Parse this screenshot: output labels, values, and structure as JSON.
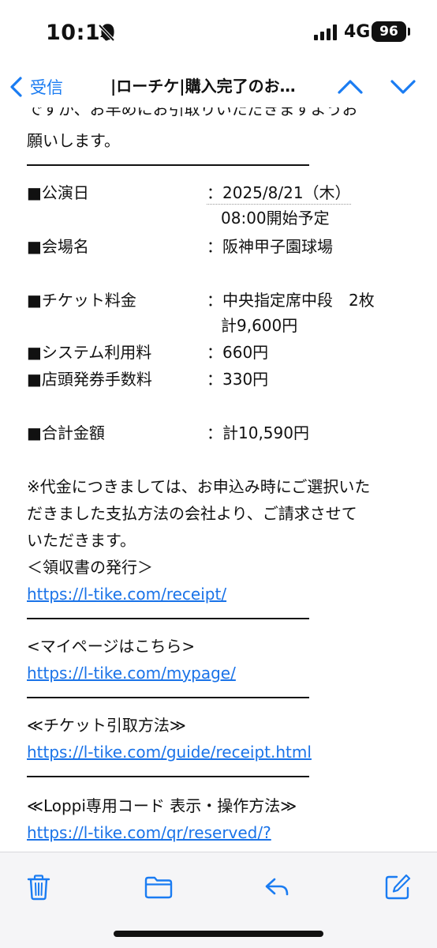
{
  "status_bar": {
    "time": "10:10",
    "network": "4G",
    "battery": "96",
    "icons": [
      "bell-slash-icon",
      "signal-icon"
    ]
  },
  "nav": {
    "back_label": "受信",
    "title": "|ローチケ|購入完了のお…",
    "accent_color": "#1a7cf2"
  },
  "email": {
    "intro_line1": "ですが、お早めにお引取りいただきますようお",
    "intro_line2": "願いします。",
    "rows": [
      {
        "label": "■公演日",
        "value": "：2025/8/21（木）",
        "value2": "08:00開始予定"
      },
      {
        "label": "■会場名",
        "value": "：阪神甲子園球場"
      },
      {
        "label": "■チケット料金",
        "value": "：中央指定席中段　2枚",
        "value2": "計9,600円"
      },
      {
        "label": "■システム利用料",
        "value": "：660円"
      },
      {
        "label": "■店頭発券手数料",
        "value": "：330円"
      },
      {
        "label": "■合計金額",
        "value": "：計10,590円"
      }
    ],
    "note_line1": "※代金につきましては、お申込み時にご選択いた",
    "note_line2": "だきました支払方法の会社より、ご請求させて",
    "note_line3": "いただきます。",
    "receipt_heading": "＜領収書の発行＞",
    "receipt_link": "https://l-tike.com/receipt/",
    "mypage_heading": "<マイページはこちら>",
    "mypage_link": "https://l-tike.com/mypage/",
    "guide_heading": "≪チケット引取方法≫",
    "guide_link": "https://l-tike.com/guide/receipt.html",
    "loppi_heading": "≪Loppi専用コード 表示・操作方法≫",
    "loppi_link": "https://l-tike.com/qr/reserved/?"
  },
  "toolbar": {
    "icons": [
      "trash-icon",
      "folder-icon",
      "reply-icon",
      "compose-icon"
    ]
  }
}
